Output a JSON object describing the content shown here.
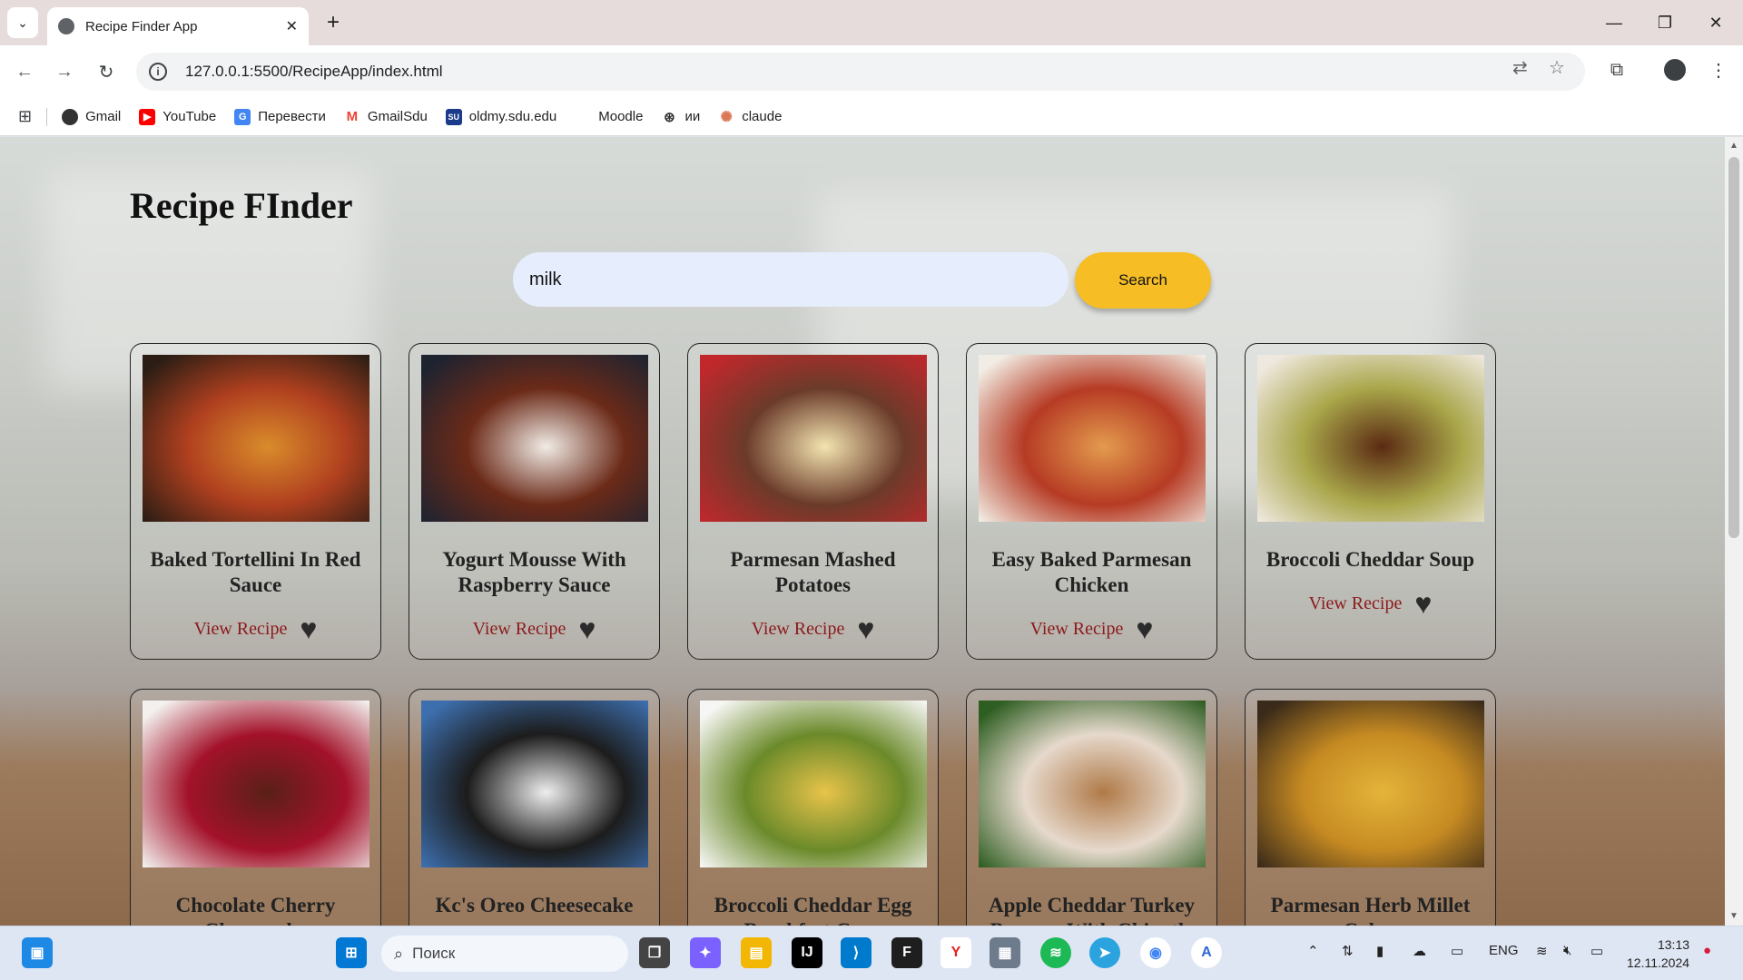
{
  "browser": {
    "tab_title": "Recipe Finder App",
    "url": "127.0.0.1:5500/RecipeApp/index.html",
    "bookmarks": [
      {
        "label": "Gmail",
        "icon": "globe-icon",
        "color": "#333333"
      },
      {
        "label": "YouTube",
        "icon": "youtube-icon",
        "color": "#ff0000"
      },
      {
        "label": "Перевести",
        "icon": "translate-icon",
        "color": "#4285f4"
      },
      {
        "label": "GmailSdu",
        "icon": "gmail-icon",
        "color": "#ea4335"
      },
      {
        "label": "oldmy.sdu.edu",
        "icon": "sdu-icon",
        "color": "#1a3a8a"
      },
      {
        "label": "Moodle",
        "icon": "moodle-icon",
        "color": "#ffffff"
      },
      {
        "label": "ии",
        "icon": "openai-icon",
        "color": "#333333"
      },
      {
        "label": "claude",
        "icon": "claude-icon",
        "color": "#d97757"
      }
    ]
  },
  "app": {
    "title": "Recipe FInder",
    "search": {
      "value": "milk",
      "button": "Search"
    },
    "view_label": "View Recipe",
    "recipes": [
      {
        "name": "Baked Tortellini In Red Sauce",
        "palette": [
          "#2b1d14",
          "#d98c2b",
          "#b0401f"
        ]
      },
      {
        "name": "Yogurt Mousse With Raspberry Sauce",
        "palette": [
          "#1e2330",
          "#f1ece6",
          "#6b2a18"
        ]
      },
      {
        "name": "Parmesan Mashed Potatoes",
        "palette": [
          "#c0282c",
          "#f3e4b0",
          "#6b3b2a"
        ]
      },
      {
        "name": "Easy Baked Parmesan Chicken",
        "palette": [
          "#f2ede4",
          "#e39b4e",
          "#b63b24"
        ]
      },
      {
        "name": "Broccoli Cheddar Soup",
        "palette": [
          "#efe8de",
          "#5a2a12",
          "#a9a64a"
        ]
      },
      {
        "name": "Chocolate Cherry Cheesecake",
        "palette": [
          "#f3f0ee",
          "#5a2018",
          "#a3122a"
        ]
      },
      {
        "name": "Kc's Oreo Cheesecake",
        "palette": [
          "#3d6fae",
          "#eeeeee",
          "#1c1c1c"
        ]
      },
      {
        "name": "Broccoli Cheddar Egg Breakfast Cups",
        "palette": [
          "#f6f6f4",
          "#e8c34a",
          "#6b8a2a"
        ]
      },
      {
        "name": "Apple Cheddar Turkey Burgers With Chipotle Yogurt Sauce",
        "palette": [
          "#2f5e22",
          "#b07a48",
          "#e6d9cc"
        ]
      },
      {
        "name": "Parmesan Herb Millet Cakes",
        "palette": [
          "#3a2a1a",
          "#e4b53a",
          "#c68a22"
        ]
      }
    ]
  },
  "taskbar": {
    "search_placeholder": "Поиск",
    "lang": "ENG",
    "time": "13:13",
    "date": "12.11.2024"
  }
}
